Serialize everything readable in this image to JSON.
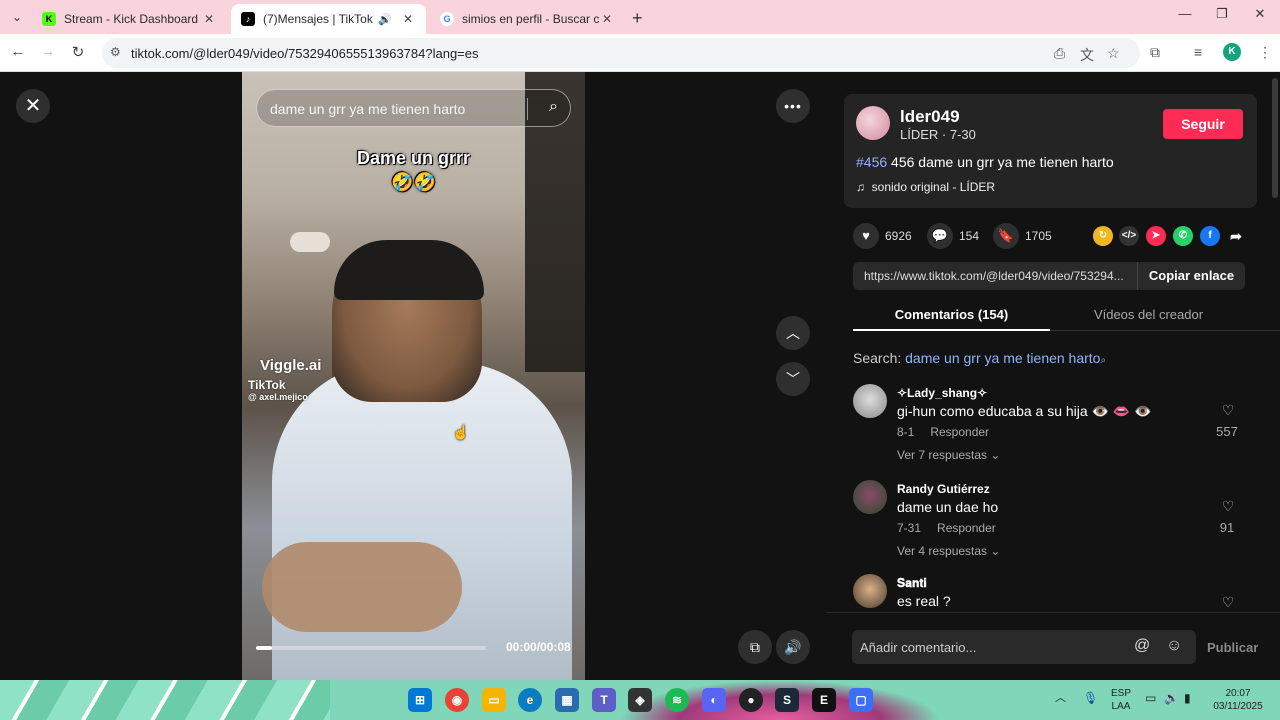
{
  "browser": {
    "tabs": [
      {
        "title": "Stream - Kick Dashboard",
        "favicon": "K"
      },
      {
        "title": "(7)Mensajes | TikTok",
        "favicon": "♪"
      },
      {
        "title": "simios en perfil - Buscar con Go",
        "favicon": "G"
      }
    ],
    "url": "tiktok.com/@lder049/video/7532940655513963784?lang=es",
    "profile_initial": "K"
  },
  "video": {
    "search_query": "dame un grr ya me tienen harto",
    "caption_line1": "Dame un grrr",
    "caption_emojis": "🤣🤣",
    "watermark_brand": "Viggle.ai",
    "watermark_tiktok": "TikTok",
    "watermark_user": "@ axel.mejico",
    "time": "00:00/00:08",
    "progress": 0.07
  },
  "creator": {
    "username": "lder049",
    "subtitle": "LÍDER · 7-30",
    "follow_label": "Seguir",
    "hashtag": "#456",
    "description": " 456 dame un grr ya me tienen harto",
    "music": "sonido original - LÍDER"
  },
  "stats": {
    "likes": "6926",
    "comments": "154",
    "saves": "1705"
  },
  "share": {
    "link": "https://www.tiktok.com/@lder049/video/753294...",
    "copy_label": "Copiar enlace"
  },
  "tabs": {
    "comments": "Comentarios (154)",
    "creator_videos": "Vídeos del creador"
  },
  "search": {
    "prefix": "Search: ",
    "keyword": "dame un grr ya me tienen harto"
  },
  "comments": [
    {
      "user": "✧Lady_shang✧",
      "text": "gi-hun como educaba a su hija 👁️ 👄 👁️",
      "date": "8-1",
      "reply": "Responder",
      "more": "Ver 7 respuestas ⌄",
      "likes": "557"
    },
    {
      "user": "Randy Gutiérrez",
      "text": "dame un dae ho",
      "date": "7-31",
      "reply": "Responder",
      "more": "Ver 4 respuestas ⌄",
      "likes": "91"
    },
    {
      "user": "𝐒𝐚𝐧𝐭𝐢",
      "text": "es real ?",
      "date": "",
      "reply": "",
      "more": "",
      "likes": ""
    }
  ],
  "comment_box": {
    "placeholder": "Añadir comentario...",
    "publish": "Publicar"
  },
  "taskbar": {
    "lang": "ESP",
    "lang2": "LAA",
    "time": "20:07",
    "date": "03/11/2025"
  }
}
